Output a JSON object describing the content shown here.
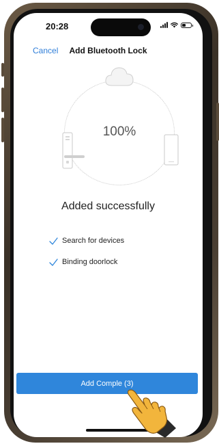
{
  "status_bar": {
    "time": "20:28",
    "icons": [
      "signal-icon",
      "wifi-icon",
      "battery-icon"
    ]
  },
  "nav": {
    "cancel_label": "Cancel",
    "title": "Add Bluetooth Lock"
  },
  "progress": {
    "percent_label": "100%",
    "value": 1.0
  },
  "illustration": {
    "icons": [
      "cloud-icon",
      "door-lock-icon",
      "phone-icon"
    ]
  },
  "result": {
    "message": "Added successfully"
  },
  "steps": [
    {
      "label": "Search for devices",
      "done": true
    },
    {
      "label": "Binding doorlock",
      "done": true
    }
  ],
  "action_button": {
    "label": "Add Comple     (3)"
  },
  "colors": {
    "accent": "#2f86db",
    "link": "#2f7ed8",
    "text": "#222222",
    "muted": "#555555"
  }
}
